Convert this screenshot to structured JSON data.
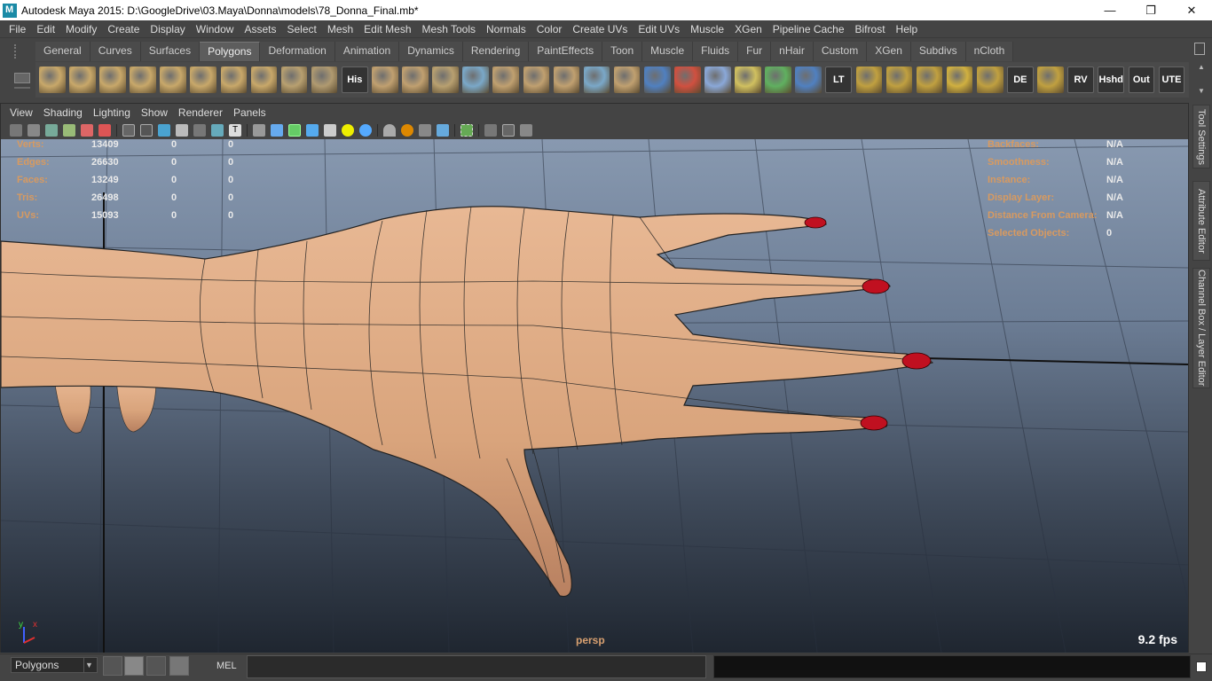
{
  "window": {
    "title": "Autodesk Maya 2015: D:\\GoogleDrive\\03.Maya\\Donna\\models\\78_Donna_Final.mb*",
    "minimize": "—",
    "maximize": "❐",
    "close": "✕"
  },
  "menubar": [
    "File",
    "Edit",
    "Modify",
    "Create",
    "Display",
    "Window",
    "Assets",
    "Select",
    "Mesh",
    "Edit Mesh",
    "Mesh Tools",
    "Normals",
    "Color",
    "Create UVs",
    "Edit UVs",
    "Muscle",
    "XGen",
    "Pipeline Cache",
    "Bifrost",
    "Help"
  ],
  "shelf": {
    "tabs": [
      "General",
      "Curves",
      "Surfaces",
      "Polygons",
      "Deformation",
      "Animation",
      "Dynamics",
      "Rendering",
      "PaintEffects",
      "Toon",
      "Muscle",
      "Fluids",
      "Fur",
      "nHair",
      "Custom",
      "XGen",
      "Subdivs",
      "nCloth"
    ],
    "active_tab": "Polygons",
    "icons": [
      {
        "name": "poly-sphere-icon",
        "color": "#c8a86a"
      },
      {
        "name": "poly-cube-icon",
        "color": "#c8a86a"
      },
      {
        "name": "poly-cylinder-icon",
        "color": "#c8a86a"
      },
      {
        "name": "poly-cone-icon",
        "color": "#c8a86a"
      },
      {
        "name": "poly-plane-icon",
        "color": "#c8a86a"
      },
      {
        "name": "poly-torus-icon",
        "color": "#c8a86a"
      },
      {
        "name": "poly-pyramid-icon",
        "color": "#c8a86a"
      },
      {
        "name": "poly-pipe-icon",
        "color": "#c8a86a"
      },
      {
        "name": "curve-on-surface-icon",
        "color": "#b8a070"
      },
      {
        "name": "sphere-grid-icon",
        "color": "#b09a70"
      },
      {
        "name": "history-icon",
        "color": "#cfcfcf",
        "text": "His"
      },
      {
        "name": "combine-icon",
        "color": "#c0a070"
      },
      {
        "name": "separate-icon",
        "color": "#c0a070"
      },
      {
        "name": "extract-icon",
        "color": "#b8a070"
      },
      {
        "name": "smooth-icon",
        "color": "#7aa8c8"
      },
      {
        "name": "fill-hole-icon",
        "color": "#c0a070"
      },
      {
        "name": "bridge-icon",
        "color": "#c0a070"
      },
      {
        "name": "append-icon",
        "color": "#c0a070"
      },
      {
        "name": "split-icon",
        "color": "#7aa8c8"
      },
      {
        "name": "extrude-icon",
        "color": "#c0a070"
      },
      {
        "name": "sculpt-icon",
        "color": "#5080c0"
      },
      {
        "name": "paint-icon",
        "color": "#d05040"
      },
      {
        "name": "wire-cage-icon",
        "color": "#8aa8d8"
      },
      {
        "name": "snap-target-icon",
        "color": "#d0c060"
      },
      {
        "name": "transform-gizmo-icon",
        "color": "#60b060"
      },
      {
        "name": "ortho-view-icon",
        "color": "#5080c0"
      },
      {
        "name": "lt-tool-icon",
        "color": "#333333",
        "text": "LT"
      },
      {
        "name": "uv-layout-icon",
        "color": "#c0a040"
      },
      {
        "name": "uv-map-icon",
        "color": "#c0a040"
      },
      {
        "name": "uv-planar-icon",
        "color": "#c0a040"
      },
      {
        "name": "uv-select-icon",
        "color": "#d0b040"
      },
      {
        "name": "uv-unfold-icon",
        "color": "#c0a040"
      },
      {
        "name": "de-tool-icon",
        "color": "#70a0c0",
        "text": "DE"
      },
      {
        "name": "uv-grid-icon",
        "color": "#c0a040"
      },
      {
        "name": "rv-icon",
        "color": "#333333",
        "text": "RV"
      },
      {
        "name": "hshd-icon",
        "color": "#333333",
        "text": "Hshd"
      },
      {
        "name": "out-icon",
        "color": "#333333",
        "text": "Out"
      },
      {
        "name": "ute-icon",
        "color": "#333333",
        "text": "UTE"
      }
    ]
  },
  "panel": {
    "menus": [
      "View",
      "Shading",
      "Lighting",
      "Show",
      "Renderer",
      "Panels"
    ]
  },
  "hud": {
    "left": [
      {
        "label": "Verts:",
        "v1": "13409",
        "v2": "0",
        "v3": "0"
      },
      {
        "label": "Edges:",
        "v1": "26630",
        "v2": "0",
        "v3": "0"
      },
      {
        "label": "Faces:",
        "v1": "13249",
        "v2": "0",
        "v3": "0"
      },
      {
        "label": "Tris:",
        "v1": "26498",
        "v2": "0",
        "v3": "0"
      },
      {
        "label": "UVs:",
        "v1": "15093",
        "v2": "0",
        "v3": "0"
      }
    ],
    "right": [
      {
        "label": "Backfaces:",
        "value": "N/A"
      },
      {
        "label": "Smoothness:",
        "value": "N/A"
      },
      {
        "label": "Instance:",
        "value": "N/A"
      },
      {
        "label": "Display Layer:",
        "value": "N/A"
      },
      {
        "label": "Distance From Camera:",
        "value": "N/A"
      },
      {
        "label": "Selected Objects:",
        "value": "0"
      }
    ],
    "camera": "persp",
    "fps": "9.2 fps",
    "axis_y": "y",
    "axis_x": "x"
  },
  "side_tabs": [
    "Tool Settings",
    "Attribute Editor",
    "Channel Box / Layer Editor"
  ],
  "cmdline": {
    "mode": "Polygons",
    "mel_label": "MEL"
  }
}
